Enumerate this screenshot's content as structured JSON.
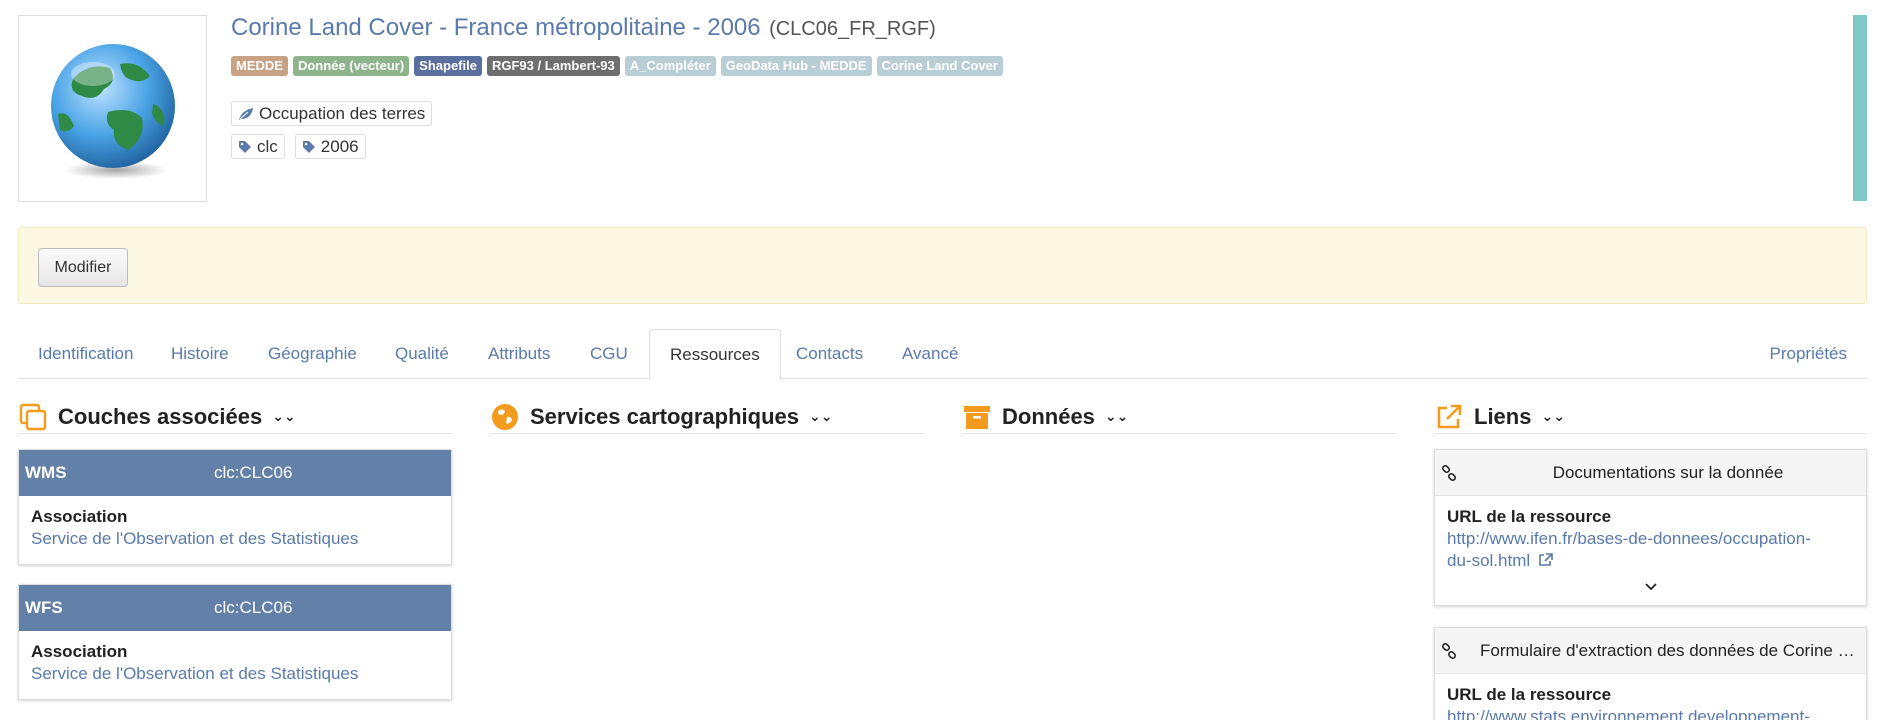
{
  "header": {
    "title": "Corine Land Cover - France métropolitaine - 2006",
    "code": "(CLC06_FR_RGF)",
    "labels": [
      {
        "text": "MEDDE",
        "color": "#c9a183"
      },
      {
        "text": "Donnée (vecteur)",
        "color": "#8db48a"
      },
      {
        "text": "Shapefile",
        "color": "#5a6f9d"
      },
      {
        "text": "RGF93 / Lambert-93",
        "color": "#6e6e6e"
      },
      {
        "text": "A_Compléter",
        "color": "#b8cdd4"
      },
      {
        "text": "GeoData Hub - MEDDE",
        "color": "#b8cdd4"
      },
      {
        "text": "Corine Land Cover",
        "color": "#b8cdd4"
      }
    ],
    "category": {
      "icon": "leaf-icon",
      "label": "Occupation des terres"
    },
    "keywords": [
      {
        "icon": "tag-icon",
        "label": "clc"
      },
      {
        "icon": "tag-icon",
        "label": "2006"
      }
    ],
    "accent_color": "#7fcac9"
  },
  "actions": {
    "edit_label": "Modifier"
  },
  "tabs": {
    "items": [
      "Identification",
      "Histoire",
      "Géographie",
      "Qualité",
      "Attributs",
      "CGU",
      "Ressources",
      "Contacts",
      "Avancé"
    ],
    "active": "Ressources",
    "right": "Propriétés"
  },
  "sections": {
    "layers": {
      "title": "Couches associées",
      "icon": "copy-icon"
    },
    "services": {
      "title": "Services cartographiques",
      "icon": "globe-icon"
    },
    "data": {
      "title": "Données",
      "icon": "archive-icon"
    },
    "links": {
      "title": "Liens",
      "icon": "external-link-icon"
    }
  },
  "layer_cards": [
    {
      "protocol": "WMS",
      "name": "clc:CLC06",
      "body_label": "Association",
      "body_link": "Service de l'Observation et des Statistiques"
    },
    {
      "protocol": "WFS",
      "name": "clc:CLC06",
      "body_label": "Association",
      "body_link": "Service de l'Observation et des Statistiques"
    }
  ],
  "link_cards": [
    {
      "title": "Documentations sur la donnée",
      "label": "URL de la ressource",
      "url_line1": "http://www.ifen.fr/bases-de-donnees/occupation-",
      "url_line2": "du-sol.html"
    },
    {
      "title": "Formulaire d'extraction des données de Corine L...",
      "label": "URL de la ressource",
      "url_line1": "http://www.stats.environnement.developpement-"
    }
  ]
}
